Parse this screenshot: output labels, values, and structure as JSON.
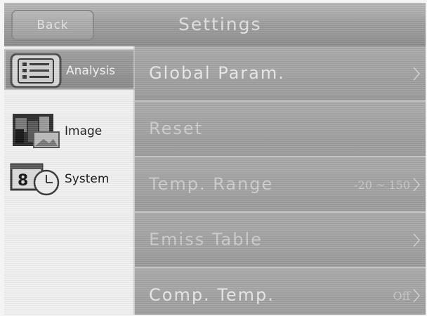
{
  "topbar": {
    "back_label": "Back",
    "title": "Settings"
  },
  "sidebar": {
    "items": [
      {
        "label": "Analysis",
        "icon": "list-icon",
        "active": true
      },
      {
        "label": "Image",
        "icon": "image-icon",
        "active": false
      },
      {
        "label": "System",
        "icon": "system-clock-icon",
        "active": false
      }
    ]
  },
  "settings": {
    "rows": [
      {
        "label": "Global Param.",
        "value": "",
        "chevron": true
      },
      {
        "label": "Reset",
        "value": "",
        "chevron": false
      },
      {
        "label": "Temp. Range",
        "value": "-20 ~ 150",
        "chevron": true
      },
      {
        "label": "Emiss Table",
        "value": "",
        "chevron": true
      },
      {
        "label": "Comp. Temp.",
        "value": "Off",
        "chevron": true
      }
    ]
  },
  "icon_text": {
    "system_digit": "8"
  },
  "colors": {
    "panel": "#9e9e9e",
    "sidebar": "#f2f2f2",
    "active_item": "#8f8f8f",
    "text_light": "#e9e9e9"
  }
}
